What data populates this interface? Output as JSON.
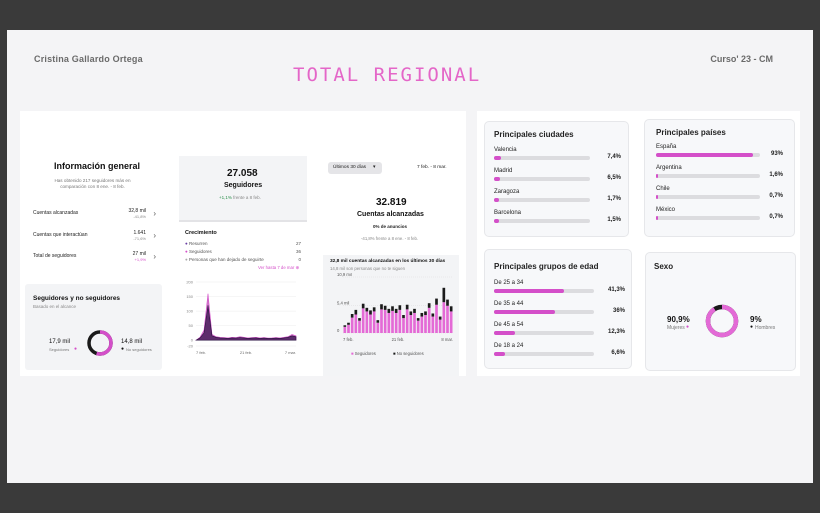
{
  "header": {
    "author": "Cristina Gallardo Ortega",
    "course": "Curso' 23 -  CM",
    "title": "TOTAL REGIONAL"
  },
  "general": {
    "title": "Información general",
    "subtitle": "Has obtenido 217 seguidores más en comparación con 8 ene. - 8 feb.",
    "rows": [
      {
        "label": "Cuentas alcanzadas",
        "value": "32,8 mil",
        "change": "-41,8%"
      },
      {
        "label": "Cuentas que interactúan",
        "value": "1.641",
        "change": "-71,6%"
      },
      {
        "label": "Total de seguidores",
        "value": "27 mil",
        "change": "+1,9%"
      }
    ]
  },
  "followers_split": {
    "title": "Seguidores y no seguidores",
    "subtitle": "Basado en el alcance",
    "left_value": "17,9 mil",
    "left_label": "Seguidores",
    "right_value": "14,8 mil",
    "right_label": "No seguidores",
    "followers_fraction": 0.547
  },
  "followers_card": {
    "value": "27.058",
    "label": "Seguidores",
    "change": "+1,1%",
    "period": "frente a 8 feb.",
    "growth_title": "Crecimiento",
    "growth_rows": [
      {
        "label": "Resurren",
        "value": "27"
      },
      {
        "label": "Seguidores",
        "value": "36"
      },
      {
        "label": "Personas que han dejado de seguirte",
        "value": "0"
      }
    ],
    "link": "Ver hasta 7 de mar",
    "ticks_y": [
      "200",
      "150",
      "100",
      "50",
      "0",
      "-20"
    ],
    "ticks_x": [
      "7 feb.",
      "21 feb.",
      "7 mar."
    ]
  },
  "reach_card": {
    "filter": "Últimos 30 días",
    "range": "7 feb. - 8 mar.",
    "value": "32.819",
    "label": "Cuentas alcanzadas",
    "ads": "0% de anuncios",
    "change": "-41,8% frente a 8 ene. - 8 feb.",
    "chart_title": "32,8 mil cuentas alcanzadas en los últimos 30 días",
    "chart_sub": "14,8 mil son personas que no te siguen",
    "ticks_y": [
      "10,9 mil",
      "5,4 mil",
      "0"
    ],
    "ticks_x": [
      "7 feb.",
      "21 feb.",
      "8 mar."
    ],
    "legend": [
      "Seguidores",
      "No seguidores"
    ]
  },
  "chart_data": [
    {
      "type": "area",
      "x": [
        "7 feb.",
        "21 feb.",
        "7 mar."
      ],
      "ylim": [
        -20,
        200
      ],
      "series": [
        {
          "name": "Seguidores",
          "values": [
            0,
            10,
            35,
            160,
            20,
            12,
            10,
            9,
            8,
            10,
            9,
            12,
            10,
            8,
            9,
            10,
            8,
            9,
            7,
            8,
            9,
            8,
            10,
            12,
            20,
            15
          ]
        },
        {
          "name": "Resurren",
          "values": [
            0,
            8,
            25,
            120,
            15,
            10,
            8,
            7,
            6,
            8,
            7,
            9,
            8,
            6,
            7,
            8,
            6,
            7,
            6,
            6,
            7,
            6,
            8,
            10,
            15,
            12
          ]
        }
      ]
    },
    {
      "type": "bar",
      "ylim": [
        0,
        10.9
      ],
      "series": [
        {
          "name": "Seguidores",
          "values": [
            1.2,
            1.6,
            3.0,
            3.6,
            2.4,
            4.8,
            4.2,
            3.6,
            4.2,
            2.0,
            4.6,
            4.5,
            3.9,
            4.3,
            3.9,
            4.5,
            2.9,
            4.6,
            3.5,
            3.9,
            2.4,
            3.2,
            3.5,
            4.9,
            3.2,
            5.5,
            2.6,
            6.0,
            5.3,
            4.2
          ]
        },
        {
          "name": "No seguidores",
          "values": [
            0.3,
            0.4,
            0.7,
            0.9,
            0.5,
            0.9,
            0.7,
            0.8,
            0.8,
            0.5,
            1.0,
            0.8,
            0.8,
            0.9,
            0.8,
            0.9,
            0.6,
            0.9,
            0.7,
            0.8,
            0.5,
            0.7,
            0.7,
            0.9,
            0.6,
            1.2,
            0.6,
            2.8,
            1.2,
            1.0
          ]
        }
      ]
    }
  ],
  "cities": {
    "title": "Principales ciudades",
    "items": [
      {
        "label": "Valencia",
        "value": "7,4%",
        "frac": 0.074
      },
      {
        "label": "Madrid",
        "value": "6,5%",
        "frac": 0.065
      },
      {
        "label": "Zaragoza",
        "value": "1,7%",
        "frac": 0.017
      },
      {
        "label": "Barcelona",
        "value": "1,5%",
        "frac": 0.015
      }
    ]
  },
  "countries": {
    "title": "Principales países",
    "items": [
      {
        "label": "España",
        "value": "93%",
        "frac": 0.93
      },
      {
        "label": "Argentina",
        "value": "1,6%",
        "frac": 0.016
      },
      {
        "label": "Chile",
        "value": "0,7%",
        "frac": 0.007
      },
      {
        "label": "México",
        "value": "0,7%",
        "frac": 0.007
      }
    ]
  },
  "ages": {
    "title": "Principales grupos de edad",
    "items": [
      {
        "label": "De 25 a 34",
        "value": "41,3%",
        "frac": 0.413
      },
      {
        "label": "De 35 a 44",
        "value": "36%",
        "frac": 0.36
      },
      {
        "label": "De 45 a 54",
        "value": "12,3%",
        "frac": 0.123
      },
      {
        "label": "De 18 a 24",
        "value": "6,6%",
        "frac": 0.066
      }
    ]
  },
  "sex": {
    "title": "Sexo",
    "women_value": "90,9%",
    "women_label": "Mujeres",
    "men_value": "9%",
    "men_label": "Hombres",
    "women_fraction": 0.909
  },
  "colors": {
    "accent": "#d44fc9",
    "dark": "#1a1a1a",
    "title_pink": "#e466c8"
  }
}
